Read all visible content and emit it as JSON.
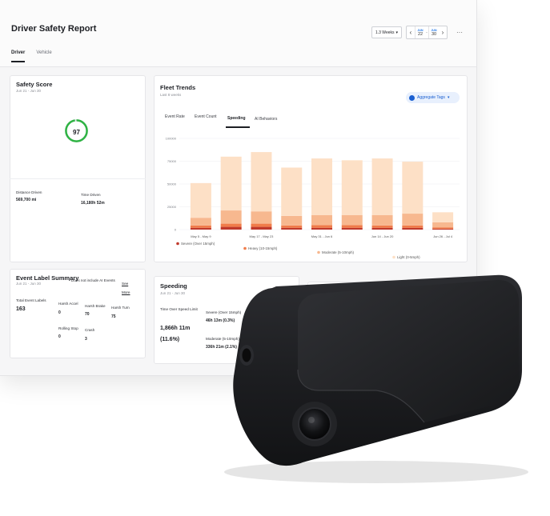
{
  "header": {
    "title": "Driver Safety Report",
    "tabs": [
      "Driver",
      "Vehicle"
    ],
    "range_select": "1.3 Weeks",
    "date_from": {
      "month": "JUN",
      "day": "22"
    },
    "date_to": {
      "month": "JUN",
      "day": "30"
    },
    "more_label": "···"
  },
  "safety_score": {
    "title": "Safety Score",
    "subtitle": "Jun 21 - Jun 30",
    "score": "97",
    "distance_label": "Distance Driven",
    "distance_value": "569,700 mi",
    "time_label": "Time Driven",
    "time_value": "16,180h 52m"
  },
  "fleet_trends": {
    "title": "Fleet Trends",
    "subtitle": "Last 8 weeks",
    "tabs": [
      "Event Rate",
      "Event Count",
      "Speeding",
      "AI Behaviors"
    ],
    "aggregate_label": "Aggregate Tags",
    "aggregate_count": "1"
  },
  "chart_data": {
    "type": "bar",
    "stacked": true,
    "categories": [
      "May 5 - May 9",
      "",
      "May 17 - May 23",
      "",
      "May 31 - Jun 6",
      "",
      "Jun 14 - Jun 20",
      "",
      "Jun 26 - Jul 4"
    ],
    "yticks": [
      "100000",
      "75000",
      "50000",
      "25000",
      "0"
    ],
    "ylim": [
      0,
      100000
    ],
    "series": [
      {
        "name": "Severe (Over 15mph)",
        "color": "#c0392b",
        "values": [
          2000,
          3000,
          3000,
          2000,
          2000,
          2000,
          2000,
          2000,
          1000
        ]
      },
      {
        "name": "Heavy (10-15mph)",
        "color": "#f07c4a",
        "values": [
          2500,
          3500,
          3500,
          2500,
          3000,
          3000,
          2500,
          2500,
          1500
        ]
      },
      {
        "name": "Moderate (5-10mph)",
        "color": "#f7b88f",
        "values": [
          8500,
          14500,
          13500,
          10500,
          11000,
          11000,
          11500,
          13000,
          5500
        ]
      },
      {
        "name": "Light (0-5mph)",
        "color": "#fde0c6",
        "values": [
          38000,
          59000,
          65000,
          53000,
          62000,
          60000,
          62000,
          57000,
          11000
        ]
      }
    ],
    "legend_position": "bottom",
    "grid": true
  },
  "event_summary": {
    "title": "Event Label Summary",
    "subtitle": "Jun 21 - Jun 30",
    "note": "Does not include AI Events",
    "see_more": "See More",
    "total_label": "Total Event Labels",
    "total_value": "163",
    "items": [
      {
        "label": "Harsh Accel",
        "value": "0"
      },
      {
        "label": "Harsh Brake",
        "value": "70"
      },
      {
        "label": "Harsh Turn",
        "value": "75"
      },
      {
        "label": "Rolling Stop",
        "value": "0"
      },
      {
        "label": "Crash",
        "value": "3"
      }
    ]
  },
  "speeding": {
    "title": "Speeding",
    "subtitle": "Jun 21 - Jun 30",
    "time_over_label": "Time Over Speed Limit",
    "time_over_value": "1,866h 11m",
    "time_over_pct": "(11.6%)",
    "severe_label": "Severe (Over 15mph)",
    "severe_value": "46h 13m (0.3%)",
    "moderate_label": "Moderate (5-10mph)",
    "moderate_value": "336h 21m (2.1%)"
  },
  "colors": {
    "accent_blue": "#1a5fd1",
    "score_green": "#2fb344",
    "device_body": "#1e1f22"
  }
}
